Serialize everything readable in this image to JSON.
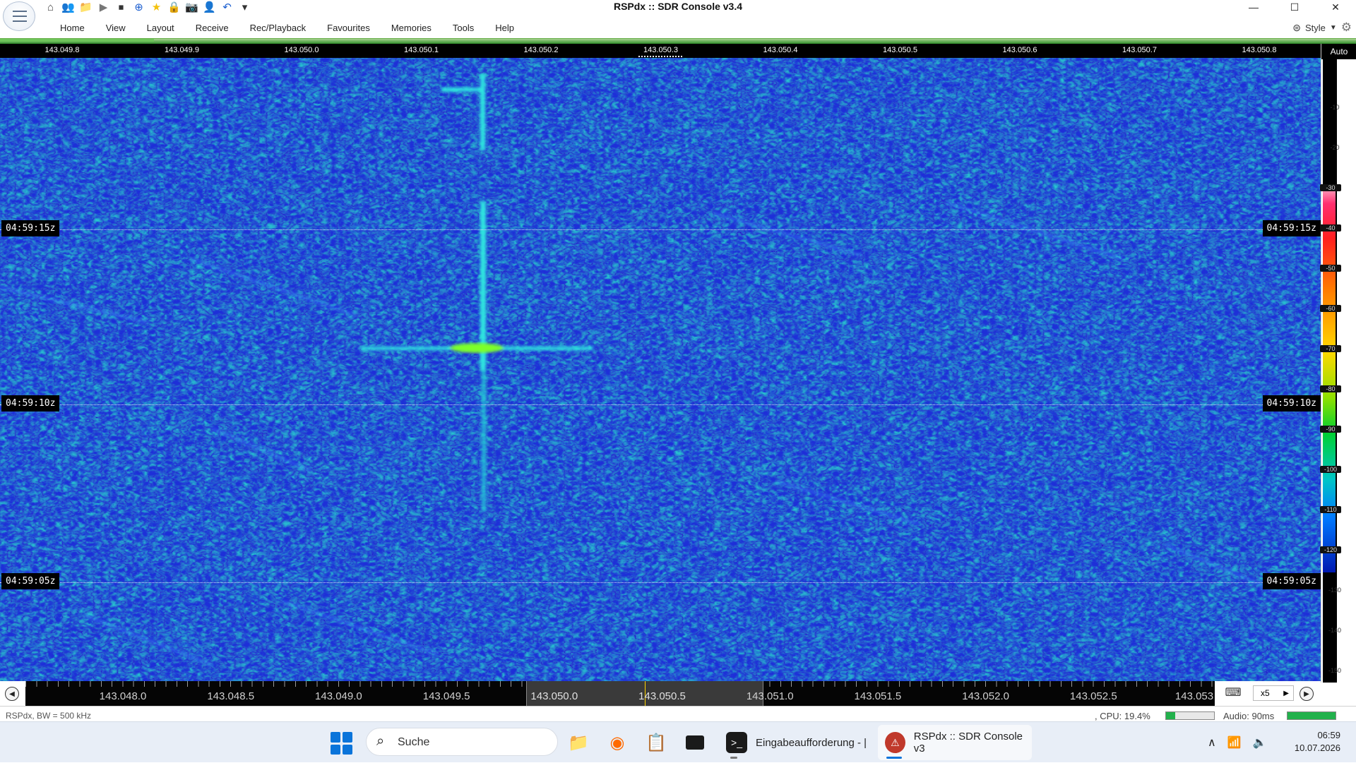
{
  "window": {
    "title": "RSPdx :: SDR Console v3.4"
  },
  "quick_access": [
    {
      "name": "home-icon",
      "glyph": "⌂",
      "color": "#444444"
    },
    {
      "name": "users-icon",
      "glyph": "👥",
      "color": "#333333"
    },
    {
      "name": "folder-icon",
      "glyph": "📁",
      "color": "#e0b040"
    },
    {
      "name": "play-icon",
      "glyph": "▶",
      "color": "#777777"
    },
    {
      "name": "stop-icon",
      "glyph": "⏹",
      "color": "#333333"
    },
    {
      "name": "add-icon",
      "glyph": "⊕",
      "color": "#1c5fd0"
    },
    {
      "name": "star-icon",
      "glyph": "★",
      "color": "#f4c20d"
    },
    {
      "name": "lock-icon",
      "glyph": "🔒",
      "color": "#d4a200"
    },
    {
      "name": "camera-icon",
      "glyph": "📷",
      "color": "#333333"
    },
    {
      "name": "user-icon",
      "glyph": "👤",
      "color": "#6b7a90"
    },
    {
      "name": "undo-icon",
      "glyph": "↶",
      "color": "#1c5fd0"
    },
    {
      "name": "customize-icon",
      "glyph": "▾",
      "color": "#333333"
    }
  ],
  "window_controls": {
    "minimize": "—",
    "maximize": "☐",
    "close": "✕"
  },
  "menu": [
    "Home",
    "View",
    "Layout",
    "Receive",
    "Rec/Playback",
    "Favourites",
    "Memories",
    "Tools",
    "Help"
  ],
  "menubar_right": {
    "style_label": "Style"
  },
  "top_ruler": {
    "labels": [
      "143.049.8",
      "143.049.9",
      "143.050.0",
      "143.050.1",
      "143.050.2",
      "143.050.3",
      "143.050.4",
      "143.050.5",
      "143.050.6",
      "143.050.7",
      "143.050.8"
    ]
  },
  "waterfall": {
    "time_markers": [
      {
        "label": "04:59:15z"
      },
      {
        "label": "04:59:10z"
      },
      {
        "label": "04:59:05z"
      }
    ]
  },
  "db_scale": {
    "auto_label": "Auto",
    "labels": [
      "-10",
      "-20",
      "-30",
      "-40",
      "-50",
      "-60",
      "-70",
      "-80",
      "-90",
      "-100",
      "-110",
      "-120",
      "-130",
      "-140",
      "-150"
    ]
  },
  "bottom_ruler": {
    "labels": [
      "143.048.0",
      "143.048.5",
      "143.049.0",
      "143.049.5",
      "143.050.0",
      "143.050.5",
      "143.051.0",
      "143.051.5",
      "143.052.0",
      "143.052.5",
      "143.053"
    ],
    "zoom": "x5"
  },
  "status": {
    "left_text": "RSPdx, BW = 500 kHz",
    "cpu_text": ", CPU: 19.4%",
    "cpu_level": 0.194,
    "audio_text": "Audio: 90ms",
    "audio_level": 1.0
  },
  "taskbar": {
    "search_placeholder": "Suche",
    "apps": [
      {
        "label": "Eingabeaufforderung - |"
      },
      {
        "label": "RSPdx :: SDR Console v3"
      }
    ],
    "clock_time": "06:59",
    "clock_date": "10.07.2026"
  },
  "colors": {
    "waterfall_base": "#1b2bd0",
    "signal": "#2ee6e0",
    "signal_peak": "#7dff2a",
    "accent_taskbar": "#0a74da"
  }
}
